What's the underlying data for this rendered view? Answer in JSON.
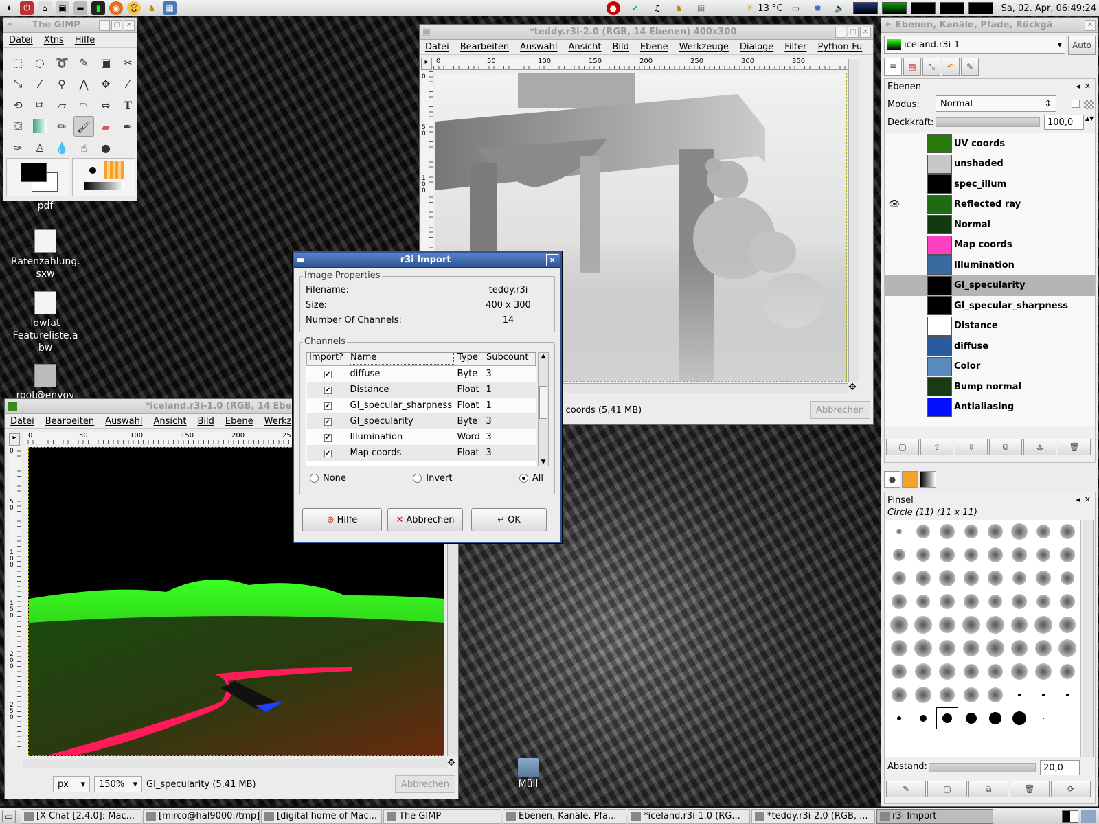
{
  "top_panel": {
    "weather": "13 °C",
    "clock": "Sa, 02. Apr, 06:49:24"
  },
  "desktop_icons": [
    {
      "label": "pdf",
      "icon": "pdf-file-icon"
    },
    {
      "label": "Ratenzahlung.\nsxw",
      "icon": "sxw-file-icon"
    },
    {
      "label": "lowfat\nFeatureliste.a\nbw",
      "icon": "abw-file-icon"
    },
    {
      "label": "root@envoy",
      "icon": "ssh-terminal-icon"
    },
    {
      "label": "Müll",
      "icon": "trash-icon"
    }
  ],
  "toolbox": {
    "title": "The GIMP",
    "menu": [
      "Datei",
      "Xtns",
      "Hilfe"
    ]
  },
  "teddy_window": {
    "title": "*teddy.r3i-2.0 (RGB, 14 Ebenen) 400x300",
    "menu": [
      "Datei",
      "Bearbeiten",
      "Auswahl",
      "Ansicht",
      "Bild",
      "Ebene",
      "Werkzeuge",
      "Dialoge",
      "Filter",
      "Python-Fu"
    ],
    "ruler": [
      "0",
      "50",
      "100",
      "150",
      "200",
      "250",
      "300",
      "350"
    ],
    "vruler": [
      "0",
      "50",
      "100"
    ],
    "status": "UV coords (5,41 MB)",
    "cancel": "Abbrechen"
  },
  "iceland_window": {
    "title": "*iceland.r3i-1.0 (RGB, 14 Ebenen) 40",
    "menu": [
      "Datei",
      "Bearbeiten",
      "Auswahl",
      "Ansicht",
      "Bild",
      "Ebene",
      "Werkz"
    ],
    "ruler": [
      "0",
      "50",
      "100",
      "150",
      "200",
      "25"
    ],
    "vruler": [
      "0",
      "50",
      "100",
      "150",
      "200",
      "250"
    ],
    "unit": "px",
    "zoom": "150%",
    "status": "GI_specularity (5,41 MB)",
    "cancel": "Abbrechen"
  },
  "dialog": {
    "title": "r3i Import",
    "props_label": "Image Properties",
    "props": [
      {
        "key": "Filename:",
        "value": "teddy.r3i"
      },
      {
        "key": "Size:",
        "value": "400 x 300"
      },
      {
        "key": "Number Of Channels:",
        "value": "14"
      }
    ],
    "channels_label": "Channels",
    "columns": [
      "Import?",
      "Name",
      "Type",
      "Subcount"
    ],
    "rows": [
      {
        "checked": true,
        "name": "diffuse",
        "type": "Byte",
        "subcount": "3"
      },
      {
        "checked": true,
        "name": "Distance",
        "type": "Float",
        "subcount": "1"
      },
      {
        "checked": true,
        "name": "GI_specular_sharpness",
        "type": "Float",
        "subcount": "1"
      },
      {
        "checked": true,
        "name": "GI_specularity",
        "type": "Byte",
        "subcount": "3"
      },
      {
        "checked": true,
        "name": "Illumination",
        "type": "Word",
        "subcount": "3"
      },
      {
        "checked": true,
        "name": "Map coords",
        "type": "Float",
        "subcount": "3"
      }
    ],
    "radios": [
      {
        "label": "None",
        "on": false
      },
      {
        "label": "Invert",
        "on": false
      },
      {
        "label": "All",
        "on": true
      }
    ],
    "buttons": {
      "help": "Hilfe",
      "cancel": "Abbrechen",
      "ok": "OK"
    }
  },
  "layers_panel": {
    "title": "Ebenen, Kanäle, Pfade, Rückgä",
    "image_select": "iceland.r3i-1",
    "auto": "Auto",
    "section": "Ebenen",
    "mode_label": "Modus:",
    "mode": "Normal",
    "opacity_label": "Deckkraft:",
    "opacity": "100,0",
    "layers": [
      {
        "name": "UV coords",
        "thumb": "#2a7a10",
        "visible": false,
        "selected": false
      },
      {
        "name": "unshaded",
        "thumb": "#c8c8c8",
        "visible": false,
        "selected": false
      },
      {
        "name": "spec_illum",
        "thumb": "#000000",
        "visible": false,
        "selected": false
      },
      {
        "name": "Reflected ray",
        "thumb": "#1f6a12",
        "visible": true,
        "selected": false
      },
      {
        "name": "Normal",
        "thumb": "#123a10",
        "visible": false,
        "selected": false
      },
      {
        "name": "Map coords",
        "thumb": "#ff40c0",
        "visible": false,
        "selected": false
      },
      {
        "name": "Illumination",
        "thumb": "#3a6aa0",
        "visible": false,
        "selected": false
      },
      {
        "name": "GI_specularity",
        "thumb": "#000000",
        "visible": false,
        "selected": true
      },
      {
        "name": "GI_specular_sharpness",
        "thumb": "#000000",
        "visible": false,
        "selected": false
      },
      {
        "name": "Distance",
        "thumb": "#ffffff",
        "visible": false,
        "selected": false
      },
      {
        "name": "diffuse",
        "thumb": "#2a5aa0",
        "visible": false,
        "selected": false
      },
      {
        "name": "Color",
        "thumb": "#5a8ac0",
        "visible": false,
        "selected": false
      },
      {
        "name": "Bump normal",
        "thumb": "#1a3a12",
        "visible": false,
        "selected": false
      },
      {
        "name": "Antialiasing",
        "thumb": "#0010ff",
        "visible": false,
        "selected": false
      }
    ],
    "brushes_title": "Pinsel",
    "brush_name": "Circle (11) (11 x 11)",
    "spacing_label": "Abstand:",
    "spacing": "20,0"
  },
  "taskbar": [
    {
      "label": "[X-Chat [2.4.0]: Mac...",
      "active": false
    },
    {
      "label": "[mirco@hal9000:/tmp]",
      "active": false
    },
    {
      "label": "[digital home of Mac...",
      "active": false
    },
    {
      "label": "The GIMP",
      "active": false
    },
    {
      "label": "Ebenen, Kanäle, Pfa...",
      "active": false
    },
    {
      "label": "*iceland.r3i-1.0 (RG...",
      "active": false
    },
    {
      "label": "*teddy.r3i-2.0 (RGB, ...",
      "active": false
    },
    {
      "label": "r3i Import",
      "active": true
    }
  ]
}
